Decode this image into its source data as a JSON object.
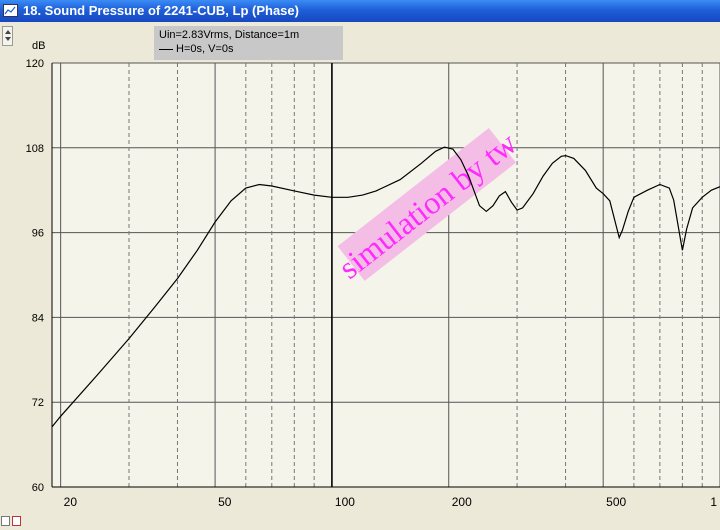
{
  "window": {
    "title": "18. Sound Pressure of 2241-CUB, Lp (Phase)"
  },
  "legend": {
    "line1": "Uin=2.83Vrms, Distance=1m",
    "line2": "H=0s, V=0s"
  },
  "watermark": {
    "text": "simulation by tw",
    "color": "#ff2aff",
    "background": "#f4bde6"
  },
  "colors": {
    "titlebar": "#1f5fd8",
    "plot_background": "#f5f4ea",
    "curve": "#000000",
    "grid": "#555555"
  },
  "chart_data": {
    "type": "line",
    "title": "",
    "xlabel": "",
    "ylabel": "dB",
    "x_scale": "log",
    "xlim": [
      19,
      1000
    ],
    "ylim": [
      60,
      120
    ],
    "y_ticks": [
      {
        "value": 120,
        "label": "120"
      },
      {
        "value": 108,
        "label": "108"
      },
      {
        "value": 96,
        "label": "96"
      },
      {
        "value": 84,
        "label": "84"
      },
      {
        "value": 72,
        "label": "72"
      },
      {
        "value": 60,
        "label": "60"
      }
    ],
    "x_ticks": [
      {
        "value": 20,
        "label": "20"
      },
      {
        "value": 50,
        "label": "50"
      },
      {
        "value": 100,
        "label": "100"
      },
      {
        "value": 200,
        "label": "200"
      },
      {
        "value": 500,
        "label": "500"
      },
      {
        "value": 1000,
        "label": "1"
      }
    ],
    "grid_minor_x": [
      30,
      40,
      60,
      70,
      80,
      90,
      300,
      400,
      600,
      700,
      800,
      900
    ],
    "grid_major_x": [
      100
    ],
    "series": [
      {
        "x": [
          19,
          20,
          25,
          30,
          35,
          40,
          45,
          50,
          55,
          60,
          65,
          70,
          80,
          90,
          100,
          110,
          120,
          130,
          150,
          170,
          185,
          195,
          205,
          215,
          225,
          240,
          250,
          260,
          270,
          280,
          290,
          300,
          310,
          330,
          350,
          370,
          390,
          400,
          420,
          450,
          480,
          500,
          520,
          540,
          550,
          560,
          580,
          600,
          650,
          700,
          740,
          760,
          780,
          800,
          820,
          850,
          900,
          950,
          1000
        ],
        "y": [
          68.5,
          70,
          76,
          81,
          85.5,
          89.5,
          93.5,
          97.5,
          100.5,
          102.3,
          102.8,
          102.6,
          101.9,
          101.3,
          101,
          101,
          101.3,
          101.9,
          103.5,
          105.8,
          107.5,
          108.1,
          107.8,
          106.3,
          104,
          99.8,
          99,
          99.8,
          101.2,
          101.8,
          100.3,
          99.2,
          99.5,
          101.5,
          104,
          105.8,
          106.8,
          106.9,
          106.5,
          104.8,
          102.3,
          101.5,
          100.5,
          97,
          95.3,
          96.3,
          99,
          101,
          102,
          102.8,
          102.3,
          100.6,
          97,
          93.5,
          96.5,
          99.5,
          101,
          102,
          102.5
        ]
      }
    ]
  }
}
